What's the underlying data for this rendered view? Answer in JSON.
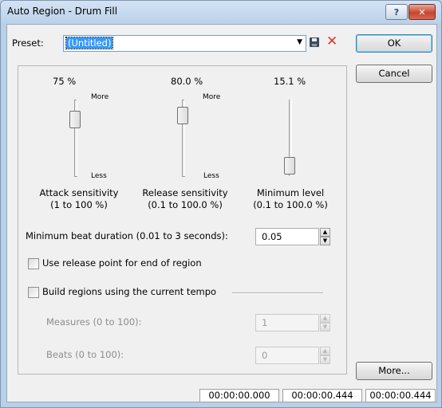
{
  "window": {
    "title": "Auto Region - Drum Fill",
    "help_glyph": "?",
    "close_glyph": "✕"
  },
  "preset": {
    "label": "Preset:",
    "value": "(Untitled)",
    "arrow": "▼",
    "delete_glyph": "✕"
  },
  "buttons": {
    "ok": "OK",
    "cancel": "Cancel",
    "more": "More..."
  },
  "sliders": [
    {
      "value_text": "75 %",
      "more": "More",
      "less": "Less",
      "label_line1": "Attack sensitivity",
      "label_line2": "(1 to 100 %)",
      "level": 0.75
    },
    {
      "value_text": "80.0 %",
      "more": "More",
      "less": "Less",
      "label_line1": "Release sensitivity",
      "label_line2": "(0.1 to 100.0 %)",
      "level": 0.8
    },
    {
      "value_text": "15.1 %",
      "label_line1": "Minimum level",
      "label_line2": "(0.1 to 100.0 %)",
      "level": 0.151
    }
  ],
  "min_beat": {
    "label": "Minimum beat duration (0.01 to 3 seconds):",
    "value": "0.05"
  },
  "checkboxes": {
    "release_point": {
      "label": "Use release point for end of region",
      "checked": false
    },
    "build_tempo": {
      "label": "Build regions using the current tempo",
      "checked": false
    }
  },
  "measures": {
    "label": "Measures (0 to 100):",
    "value": "1"
  },
  "beats": {
    "label": "Beats (0 to 100):",
    "value": "0"
  },
  "spin": {
    "up": "▲",
    "down": "▼"
  },
  "status": {
    "start": "00:00:00.000",
    "end": "00:00:00.444",
    "length": "00:00:00.444"
  }
}
